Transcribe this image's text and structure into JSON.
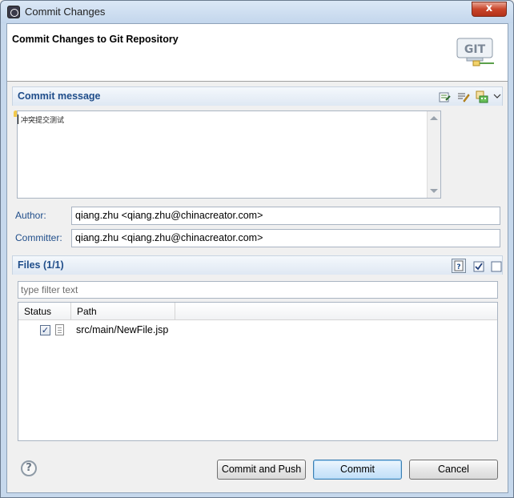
{
  "window": {
    "title": "Commit Changes",
    "close_label": "x"
  },
  "header": {
    "title": "Commit Changes to Git Repository",
    "logo_text": "GIT"
  },
  "commit_message": {
    "section_title": "Commit message",
    "text": "冲突提交测试",
    "toolbar_icons": [
      "add-signed-off-icon",
      "amend-icon",
      "select-changes-icon",
      "chevron-down-icon"
    ]
  },
  "author": {
    "label": "Author:",
    "value": "qiang.zhu <qiang.zhu@chinacreator.com>"
  },
  "committer": {
    "label": "Committer:",
    "value": "qiang.zhu <qiang.zhu@chinacreator.com>"
  },
  "files": {
    "section_title": "Files (1/1)",
    "filter_placeholder": "type filter text",
    "columns": [
      "Status",
      "Path"
    ],
    "rows": [
      {
        "checked": true,
        "path": "src/main/NewFile.jsp"
      }
    ]
  },
  "buttons": {
    "commit_and_push": "Commit and Push",
    "commit": "Commit",
    "cancel": "Cancel"
  },
  "help_glyph": "?",
  "colors": {
    "section_title": "#1f4d8a",
    "default_button_border": "#3c7fb1"
  }
}
